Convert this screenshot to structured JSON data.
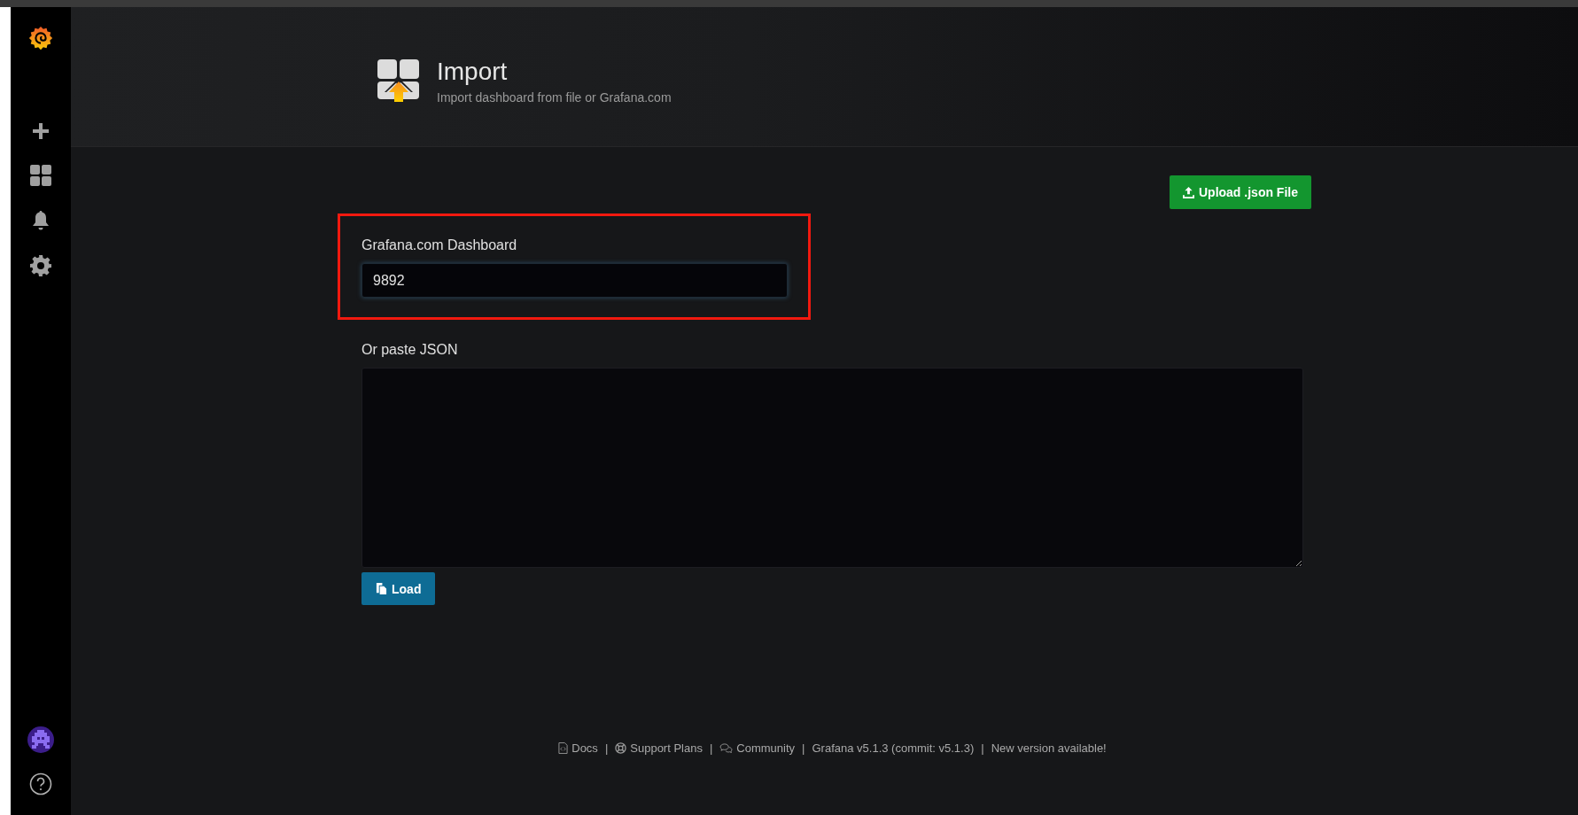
{
  "sidebar": {
    "items": [
      {
        "kind": "create"
      },
      {
        "kind": "dashboards"
      },
      {
        "kind": "alerting"
      },
      {
        "kind": "configuration"
      }
    ]
  },
  "header": {
    "title": "Import",
    "subtitle": "Import dashboard from file or Grafana.com"
  },
  "upload_button": {
    "label": "Upload .json File"
  },
  "grafana_dashboard": {
    "label": "Grafana.com Dashboard",
    "value": "9892",
    "highlighted": true
  },
  "paste_json": {
    "label": "Or paste JSON"
  },
  "load_button": {
    "label": "Load"
  },
  "footer": {
    "separator": "|",
    "items": [
      {
        "kind": "docs",
        "text": "Docs"
      },
      {
        "kind": "support",
        "text": "Support Plans"
      },
      {
        "kind": "community",
        "text": "Community"
      },
      {
        "kind": "version",
        "text": "Grafana v5.1.3 (commit: v5.1.3)"
      },
      {
        "kind": "update",
        "text": "New version available!"
      }
    ]
  }
}
